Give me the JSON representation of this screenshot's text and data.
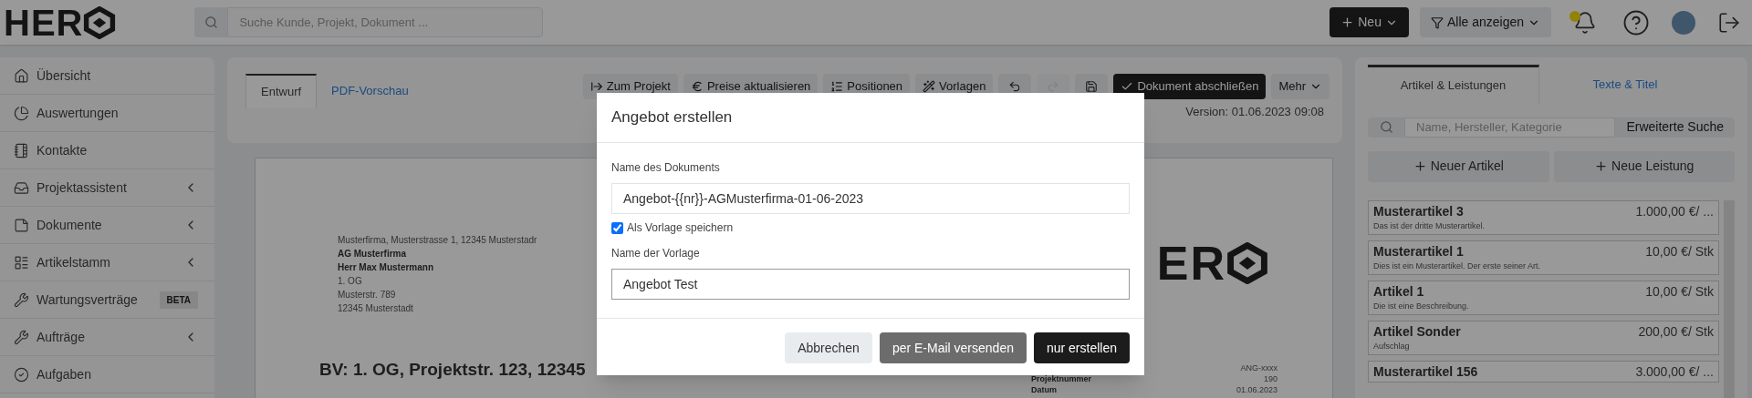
{
  "header": {
    "logo": "HER",
    "search": {
      "placeholder": "Suche Kunde, Projekt, Dokument ..."
    },
    "new_button": "Neu",
    "filter_button": "Alle anzeigen"
  },
  "sidebar": {
    "items": [
      {
        "label": "Übersicht",
        "expandable": false
      },
      {
        "label": "Auswertungen",
        "expandable": false
      },
      {
        "label": "Kontakte",
        "expandable": false
      },
      {
        "label": "Projektassistent",
        "expandable": true
      },
      {
        "label": "Dokumente",
        "expandable": true
      },
      {
        "label": "Artikelstamm",
        "expandable": true
      },
      {
        "label": "Wartungsverträge",
        "expandable": false,
        "badge": "BETA"
      },
      {
        "label": "Aufträge",
        "expandable": true
      },
      {
        "label": "Aufgaben",
        "expandable": false
      }
    ]
  },
  "editor": {
    "tabs": [
      {
        "label": "Entwurf",
        "selected": true
      },
      {
        "label": "PDF-Vorschau",
        "selected": false
      }
    ],
    "toolbar": [
      {
        "kind": "action",
        "label": "Zum Projekt",
        "disabled": false
      },
      {
        "kind": "action",
        "label": "Preise aktualisieren",
        "disabled": false
      },
      {
        "kind": "action",
        "label": "Positionen",
        "disabled": false
      },
      {
        "kind": "action",
        "label": "Vorlagen",
        "disabled": false
      },
      {
        "kind": "icon",
        "disabled": false
      },
      {
        "kind": "icon",
        "disabled": true
      },
      {
        "kind": "icon",
        "disabled": false
      },
      {
        "kind": "primary",
        "label": "Dokument abschließen",
        "disabled": false
      },
      {
        "kind": "menu",
        "label": "Mehr",
        "disabled": false
      }
    ],
    "version": "Version: 01.06.2023 09:08",
    "document": {
      "sender_line": "Musterfirma, Musterstrasse 1, 12345 Musterstadr",
      "address": [
        {
          "text": "AG Musterfirma",
          "bold": true
        },
        {
          "text": "Herr Max Mustermann",
          "bold": true
        },
        {
          "text": "1. OG",
          "bold": false
        },
        {
          "text": "Musterstr. 789",
          "bold": false
        },
        {
          "text": "12345 Musterstadt",
          "bold": false
        }
      ],
      "logo": "ER",
      "number": "ANG-xxxx",
      "meta": [
        {
          "label": "Projektnummer",
          "value": "190"
        },
        {
          "label": "Datum",
          "value": "01.06.2023"
        }
      ],
      "heading": "BV: 1. OG, Projektstr. 123, 12345"
    }
  },
  "articles": {
    "tabs": [
      {
        "label": "Artikel & Leistungen",
        "selected": true
      },
      {
        "label": "Texte & Titel",
        "selected": false
      }
    ],
    "search": {
      "placeholder": "Name, Hersteller, Kategorie",
      "button": "Erweiterte Suche"
    },
    "add_buttons": [
      "Neuer Artikel",
      "Neue Leistung"
    ],
    "items": [
      {
        "name": "Musterartikel 3",
        "price": "1.000,00 €/ ...",
        "description": "Das ist der dritte Musterartikel."
      },
      {
        "name": "Musterartikel 1",
        "price": "10,00 €/ Stk",
        "description": "Dies ist ein Musterartikel. Der erste seiner Art."
      },
      {
        "name": "Artikel 1",
        "price": "10,00 €/ Stk",
        "description": "Die ist eine Beschreibung."
      },
      {
        "name": "Artikel Sonder",
        "price": "200,00 €/ Stk",
        "description": "Aufschlag"
      },
      {
        "name": "Musterartikel 156",
        "price": "3.000,00 €/ ..."
      }
    ]
  },
  "dialog": {
    "title": "Angebot erstellen",
    "document_name": {
      "label": "Name des Dokuments",
      "value": "Angebot-{{nr}}-AGMusterfirma-01-06-2023"
    },
    "save_template": {
      "label": "Als Vorlage speichern",
      "checked": true
    },
    "template_name": {
      "label": "Name der Vorlage",
      "value": "Angebot Test"
    },
    "buttons": [
      {
        "kind": "secondary",
        "label": "Abbrechen"
      },
      {
        "kind": "muted",
        "label": "per E-Mail versenden"
      },
      {
        "kind": "primary",
        "label": "nur erstellen"
      }
    ]
  }
}
